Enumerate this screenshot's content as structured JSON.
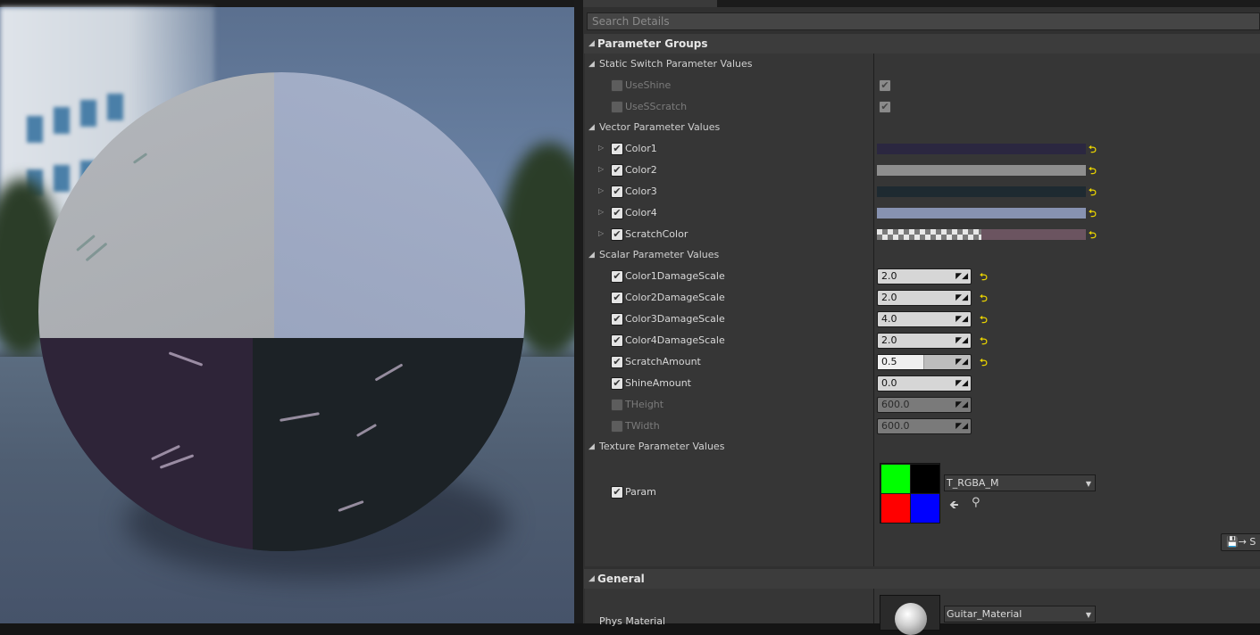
{
  "search": {
    "placeholder": "Search Details"
  },
  "categories": {
    "parameter_groups": "Parameter Groups",
    "general": "General"
  },
  "groups": {
    "static_switch": "Static Switch Parameter Values",
    "vector": "Vector Parameter Values",
    "scalar": "Scalar Parameter Values",
    "texture": "Texture Parameter Values"
  },
  "static_switch_params": [
    {
      "name": "UseShine",
      "override": false,
      "value": true
    },
    {
      "name": "UseSScratch",
      "override": false,
      "value": true
    }
  ],
  "vector_params": [
    {
      "name": "Color1",
      "override": true,
      "color": "#2b2740"
    },
    {
      "name": "Color2",
      "override": true,
      "color": "#8e8e8e"
    },
    {
      "name": "Color3",
      "override": true,
      "color": "#1e2a31"
    },
    {
      "name": "Color4",
      "override": true,
      "color": "#8792b1"
    },
    {
      "name": "ScratchColor",
      "override": true,
      "color": "#6b5460"
    }
  ],
  "scalar_params": [
    {
      "name": "Color1DamageScale",
      "override": true,
      "value": "2.0",
      "reset": true
    },
    {
      "name": "Color2DamageScale",
      "override": true,
      "value": "2.0",
      "reset": true
    },
    {
      "name": "Color3DamageScale",
      "override": true,
      "value": "4.0",
      "reset": true
    },
    {
      "name": "Color4DamageScale",
      "override": true,
      "value": "2.0",
      "reset": true
    },
    {
      "name": "ScratchAmount",
      "override": true,
      "value": "0.5",
      "reset": true,
      "slider_fraction": 0.5
    },
    {
      "name": "ShineAmount",
      "override": true,
      "value": "0.0",
      "reset": false
    },
    {
      "name": "THeight",
      "override": false,
      "value": "600.0",
      "reset": false
    },
    {
      "name": "TWidth",
      "override": false,
      "value": "600.0",
      "reset": false
    }
  ],
  "texture_param": {
    "name": "Param",
    "override": true,
    "asset": "T_RGBA_M"
  },
  "save_button": {
    "label": "S"
  },
  "general": {
    "phys_material_label": "Phys Material",
    "parent_asset": "Guitar_Material"
  },
  "icons": {
    "reset": "reset-arrow-icon",
    "expand": "triangle-right-icon",
    "collapse": "triangle-down-icon",
    "drag": "drag-arrows-icon",
    "back": "arrow-left-icon",
    "find": "magnifier-icon",
    "save": "save-icon"
  },
  "colors": {
    "reset_accent": "#e8d200",
    "panel_bg": "#303030"
  }
}
